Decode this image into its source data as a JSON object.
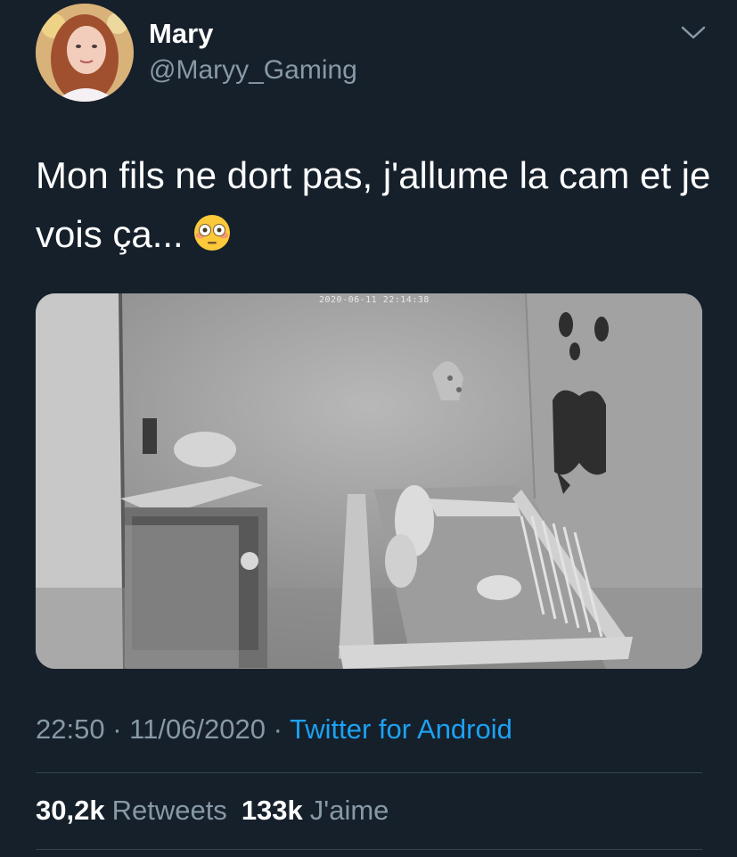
{
  "user": {
    "name": "Mary",
    "handle": "@Maryy_Gaming"
  },
  "tweet": {
    "text": "Mon fils ne dort pas, j'allume la cam et je vois ça...",
    "emoji": "flushed-face-emoji"
  },
  "media": {
    "camera_timestamp": "2020-06-11 22:14:38"
  },
  "meta": {
    "time": "22:50",
    "separator": "·",
    "date": "11/06/2020",
    "source": "Twitter for Android"
  },
  "stats": {
    "retweets_count": "30,2k",
    "retweets_label": "Retweets",
    "likes_count": "133k",
    "likes_label": "J'aime"
  },
  "colors": {
    "background": "#15202b",
    "primary_text": "#ffffff",
    "secondary_text": "#8899a6",
    "accent": "#1da1f2",
    "divider": "#38444d"
  },
  "icons": {
    "caret": "chevron-down-icon"
  }
}
